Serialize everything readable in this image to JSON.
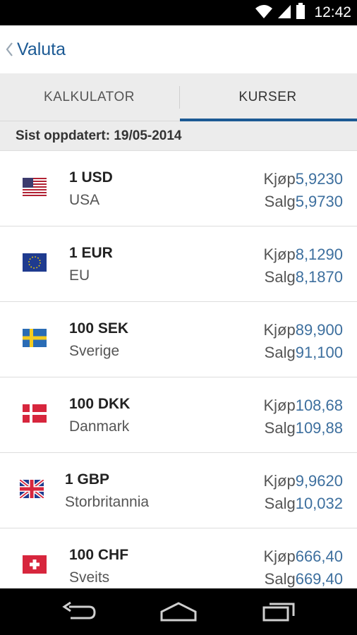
{
  "status_bar": {
    "time": "12:42",
    "icons": [
      "wifi-icon",
      "signal-icon",
      "battery-icon"
    ]
  },
  "header": {
    "title": "Valuta",
    "back_icon": "chevron-left-icon"
  },
  "tabs": [
    {
      "label": "KALKULATOR",
      "active": false
    },
    {
      "label": "KURSER",
      "active": true
    }
  ],
  "updated_text": "Sist oppdatert: 19/05-2014",
  "rates": [
    {
      "code": "1 USD",
      "country": "USA",
      "buy_label": "Kjøp",
      "buy": "5,9230",
      "sell_label": "Salg",
      "sell": "5,9730",
      "flag": "us-flag"
    },
    {
      "code": "1 EUR",
      "country": "EU",
      "buy_label": "Kjøp",
      "buy": "8,1290",
      "sell_label": "Salg",
      "sell": "8,1870",
      "flag": "eu-flag"
    },
    {
      "code": "100 SEK",
      "country": "Sverige",
      "buy_label": "Kjøp",
      "buy": "89,900",
      "sell_label": "Salg",
      "sell": "91,100",
      "flag": "se-flag"
    },
    {
      "code": "100 DKK",
      "country": "Danmark",
      "buy_label": "Kjøp",
      "buy": "108,68",
      "sell_label": "Salg",
      "sell": "109,88",
      "flag": "dk-flag"
    },
    {
      "code": "1 GBP",
      "country": "Storbritannia",
      "buy_label": "Kjøp",
      "buy": "9,9620",
      "sell_label": "Salg",
      "sell": "10,032",
      "flag": "gb-flag"
    },
    {
      "code": "100 CHF",
      "country": "Sveits",
      "buy_label": "Kjøp",
      "buy": "666,40",
      "sell_label": "Salg",
      "sell": "669,40",
      "flag": "ch-flag"
    }
  ],
  "nav": {
    "back_icon": "nav-back-icon",
    "home_icon": "nav-home-icon",
    "recents_icon": "nav-recents-icon"
  },
  "colors": {
    "accent": "#1c5a94",
    "rate_value": "#3d6f9e",
    "tab_bg": "#ececec"
  }
}
